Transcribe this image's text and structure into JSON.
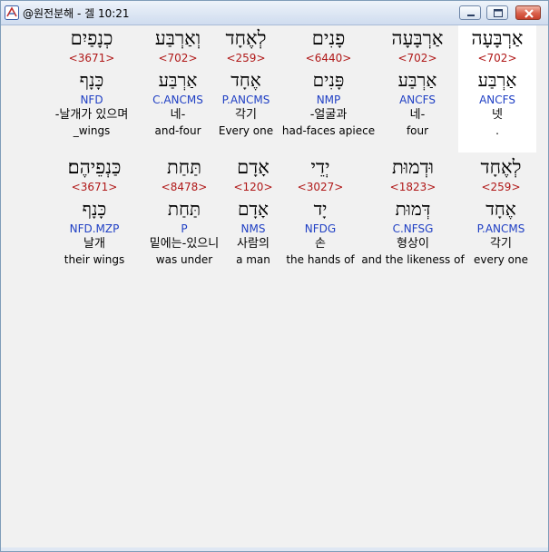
{
  "window": {
    "title": "@원전분해 - 겔 10:21",
    "icon": "app-logo-icon",
    "controls": [
      "minimize-icon",
      "maximize-icon",
      "close-icon"
    ]
  },
  "rows": [
    {
      "words": [
        {
          "hebrew": "אַרְבָּעָה",
          "strong": "<702>",
          "lemma": "אַרְבַּע",
          "morph": "ANCFS",
          "korean": "넷",
          "english": ".",
          "highlighted": true
        },
        {
          "hebrew": "אַרְבָּעָה",
          "strong": "<702>",
          "lemma": "אַרְבַּע",
          "morph": "ANCFS",
          "korean": "네-",
          "english": "four",
          "highlighted": false
        },
        {
          "hebrew": "פָנִים",
          "strong": "<6440>",
          "lemma": "פָּנִים",
          "morph": "NMP",
          "korean": "-얼굴과",
          "english": "had-faces apiece",
          "highlighted": false
        },
        {
          "hebrew": "לְאֶחָד",
          "strong": "<259>",
          "lemma": "אֶחָד",
          "morph": "P.ANCMS",
          "korean": "각기",
          "english": "Every one",
          "highlighted": false
        },
        {
          "hebrew": "וְאַרְבַּע",
          "strong": "<702>",
          "lemma": "אַרְבַּע",
          "morph": "C.ANCMS",
          "korean": "네-",
          "english": "and-four",
          "highlighted": false
        },
        {
          "hebrew": "כְנָפַיִם",
          "strong": "<3671>",
          "lemma": "כָּנָף",
          "morph": "NFD",
          "korean": "-날개가 있으며",
          "english": "_wings",
          "highlighted": false
        }
      ]
    },
    {
      "words": [
        {
          "hebrew": "לְאֶחָד",
          "strong": "<259>",
          "lemma": "אֶחָד",
          "morph": "P.ANCMS",
          "korean": "각기",
          "english": "every one",
          "highlighted": false
        },
        {
          "hebrew": "וּדְמוּת",
          "strong": "<1823>",
          "lemma": "דְּמוּת",
          "morph": "C.NFSG",
          "korean": "형상이",
          "english": "and the likeness of",
          "highlighted": false
        },
        {
          "hebrew": "יְדֵי",
          "strong": "<3027>",
          "lemma": "יָד",
          "morph": "NFDG",
          "korean": "손",
          "english": "the hands of",
          "highlighted": false
        },
        {
          "hebrew": "אָדָם",
          "strong": "<120>",
          "lemma": "אָדָם",
          "morph": "NMS",
          "korean": "사람의",
          "english": "a man",
          "highlighted": false
        },
        {
          "hebrew": "תַּחַת",
          "strong": "<8478>",
          "lemma": "תַּחַת",
          "morph": "P",
          "korean": "밑에는-있으니",
          "english": "was under",
          "highlighted": false
        },
        {
          "hebrew": "כַּנְפֵיהֶם׃",
          "strong": "<3671>",
          "lemma": "כָּנָף",
          "morph": "NFD.MZP",
          "korean": "날개",
          "english": "their wings",
          "highlighted": false
        }
      ]
    }
  ]
}
